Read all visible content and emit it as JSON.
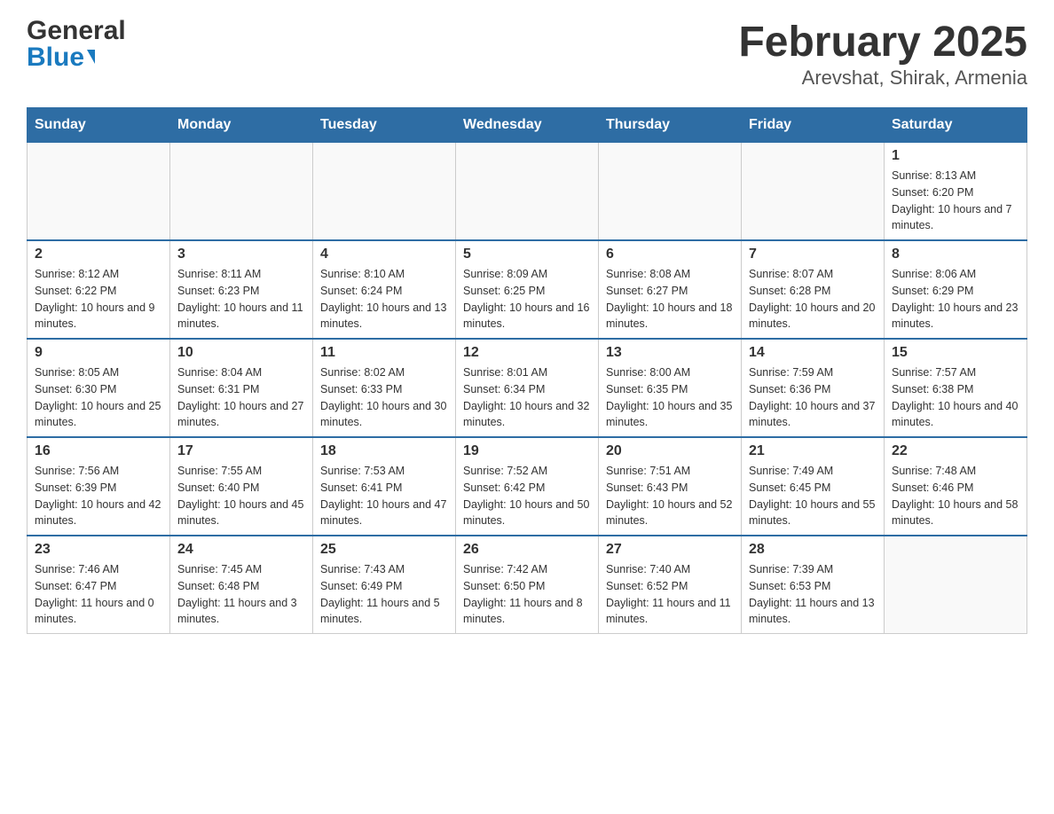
{
  "header": {
    "logo_general": "General",
    "logo_blue": "Blue",
    "title": "February 2025",
    "subtitle": "Arevshat, Shirak, Armenia"
  },
  "days_of_week": [
    "Sunday",
    "Monday",
    "Tuesday",
    "Wednesday",
    "Thursday",
    "Friday",
    "Saturday"
  ],
  "weeks": [
    [
      {
        "day": "",
        "sunrise": "",
        "sunset": "",
        "daylight": ""
      },
      {
        "day": "",
        "sunrise": "",
        "sunset": "",
        "daylight": ""
      },
      {
        "day": "",
        "sunrise": "",
        "sunset": "",
        "daylight": ""
      },
      {
        "day": "",
        "sunrise": "",
        "sunset": "",
        "daylight": ""
      },
      {
        "day": "",
        "sunrise": "",
        "sunset": "",
        "daylight": ""
      },
      {
        "day": "",
        "sunrise": "",
        "sunset": "",
        "daylight": ""
      },
      {
        "day": "1",
        "sunrise": "Sunrise: 8:13 AM",
        "sunset": "Sunset: 6:20 PM",
        "daylight": "Daylight: 10 hours and 7 minutes."
      }
    ],
    [
      {
        "day": "2",
        "sunrise": "Sunrise: 8:12 AM",
        "sunset": "Sunset: 6:22 PM",
        "daylight": "Daylight: 10 hours and 9 minutes."
      },
      {
        "day": "3",
        "sunrise": "Sunrise: 8:11 AM",
        "sunset": "Sunset: 6:23 PM",
        "daylight": "Daylight: 10 hours and 11 minutes."
      },
      {
        "day": "4",
        "sunrise": "Sunrise: 8:10 AM",
        "sunset": "Sunset: 6:24 PM",
        "daylight": "Daylight: 10 hours and 13 minutes."
      },
      {
        "day": "5",
        "sunrise": "Sunrise: 8:09 AM",
        "sunset": "Sunset: 6:25 PM",
        "daylight": "Daylight: 10 hours and 16 minutes."
      },
      {
        "day": "6",
        "sunrise": "Sunrise: 8:08 AM",
        "sunset": "Sunset: 6:27 PM",
        "daylight": "Daylight: 10 hours and 18 minutes."
      },
      {
        "day": "7",
        "sunrise": "Sunrise: 8:07 AM",
        "sunset": "Sunset: 6:28 PM",
        "daylight": "Daylight: 10 hours and 20 minutes."
      },
      {
        "day": "8",
        "sunrise": "Sunrise: 8:06 AM",
        "sunset": "Sunset: 6:29 PM",
        "daylight": "Daylight: 10 hours and 23 minutes."
      }
    ],
    [
      {
        "day": "9",
        "sunrise": "Sunrise: 8:05 AM",
        "sunset": "Sunset: 6:30 PM",
        "daylight": "Daylight: 10 hours and 25 minutes."
      },
      {
        "day": "10",
        "sunrise": "Sunrise: 8:04 AM",
        "sunset": "Sunset: 6:31 PM",
        "daylight": "Daylight: 10 hours and 27 minutes."
      },
      {
        "day": "11",
        "sunrise": "Sunrise: 8:02 AM",
        "sunset": "Sunset: 6:33 PM",
        "daylight": "Daylight: 10 hours and 30 minutes."
      },
      {
        "day": "12",
        "sunrise": "Sunrise: 8:01 AM",
        "sunset": "Sunset: 6:34 PM",
        "daylight": "Daylight: 10 hours and 32 minutes."
      },
      {
        "day": "13",
        "sunrise": "Sunrise: 8:00 AM",
        "sunset": "Sunset: 6:35 PM",
        "daylight": "Daylight: 10 hours and 35 minutes."
      },
      {
        "day": "14",
        "sunrise": "Sunrise: 7:59 AM",
        "sunset": "Sunset: 6:36 PM",
        "daylight": "Daylight: 10 hours and 37 minutes."
      },
      {
        "day": "15",
        "sunrise": "Sunrise: 7:57 AM",
        "sunset": "Sunset: 6:38 PM",
        "daylight": "Daylight: 10 hours and 40 minutes."
      }
    ],
    [
      {
        "day": "16",
        "sunrise": "Sunrise: 7:56 AM",
        "sunset": "Sunset: 6:39 PM",
        "daylight": "Daylight: 10 hours and 42 minutes."
      },
      {
        "day": "17",
        "sunrise": "Sunrise: 7:55 AM",
        "sunset": "Sunset: 6:40 PM",
        "daylight": "Daylight: 10 hours and 45 minutes."
      },
      {
        "day": "18",
        "sunrise": "Sunrise: 7:53 AM",
        "sunset": "Sunset: 6:41 PM",
        "daylight": "Daylight: 10 hours and 47 minutes."
      },
      {
        "day": "19",
        "sunrise": "Sunrise: 7:52 AM",
        "sunset": "Sunset: 6:42 PM",
        "daylight": "Daylight: 10 hours and 50 minutes."
      },
      {
        "day": "20",
        "sunrise": "Sunrise: 7:51 AM",
        "sunset": "Sunset: 6:43 PM",
        "daylight": "Daylight: 10 hours and 52 minutes."
      },
      {
        "day": "21",
        "sunrise": "Sunrise: 7:49 AM",
        "sunset": "Sunset: 6:45 PM",
        "daylight": "Daylight: 10 hours and 55 minutes."
      },
      {
        "day": "22",
        "sunrise": "Sunrise: 7:48 AM",
        "sunset": "Sunset: 6:46 PM",
        "daylight": "Daylight: 10 hours and 58 minutes."
      }
    ],
    [
      {
        "day": "23",
        "sunrise": "Sunrise: 7:46 AM",
        "sunset": "Sunset: 6:47 PM",
        "daylight": "Daylight: 11 hours and 0 minutes."
      },
      {
        "day": "24",
        "sunrise": "Sunrise: 7:45 AM",
        "sunset": "Sunset: 6:48 PM",
        "daylight": "Daylight: 11 hours and 3 minutes."
      },
      {
        "day": "25",
        "sunrise": "Sunrise: 7:43 AM",
        "sunset": "Sunset: 6:49 PM",
        "daylight": "Daylight: 11 hours and 5 minutes."
      },
      {
        "day": "26",
        "sunrise": "Sunrise: 7:42 AM",
        "sunset": "Sunset: 6:50 PM",
        "daylight": "Daylight: 11 hours and 8 minutes."
      },
      {
        "day": "27",
        "sunrise": "Sunrise: 7:40 AM",
        "sunset": "Sunset: 6:52 PM",
        "daylight": "Daylight: 11 hours and 11 minutes."
      },
      {
        "day": "28",
        "sunrise": "Sunrise: 7:39 AM",
        "sunset": "Sunset: 6:53 PM",
        "daylight": "Daylight: 11 hours and 13 minutes."
      },
      {
        "day": "",
        "sunrise": "",
        "sunset": "",
        "daylight": ""
      }
    ]
  ]
}
